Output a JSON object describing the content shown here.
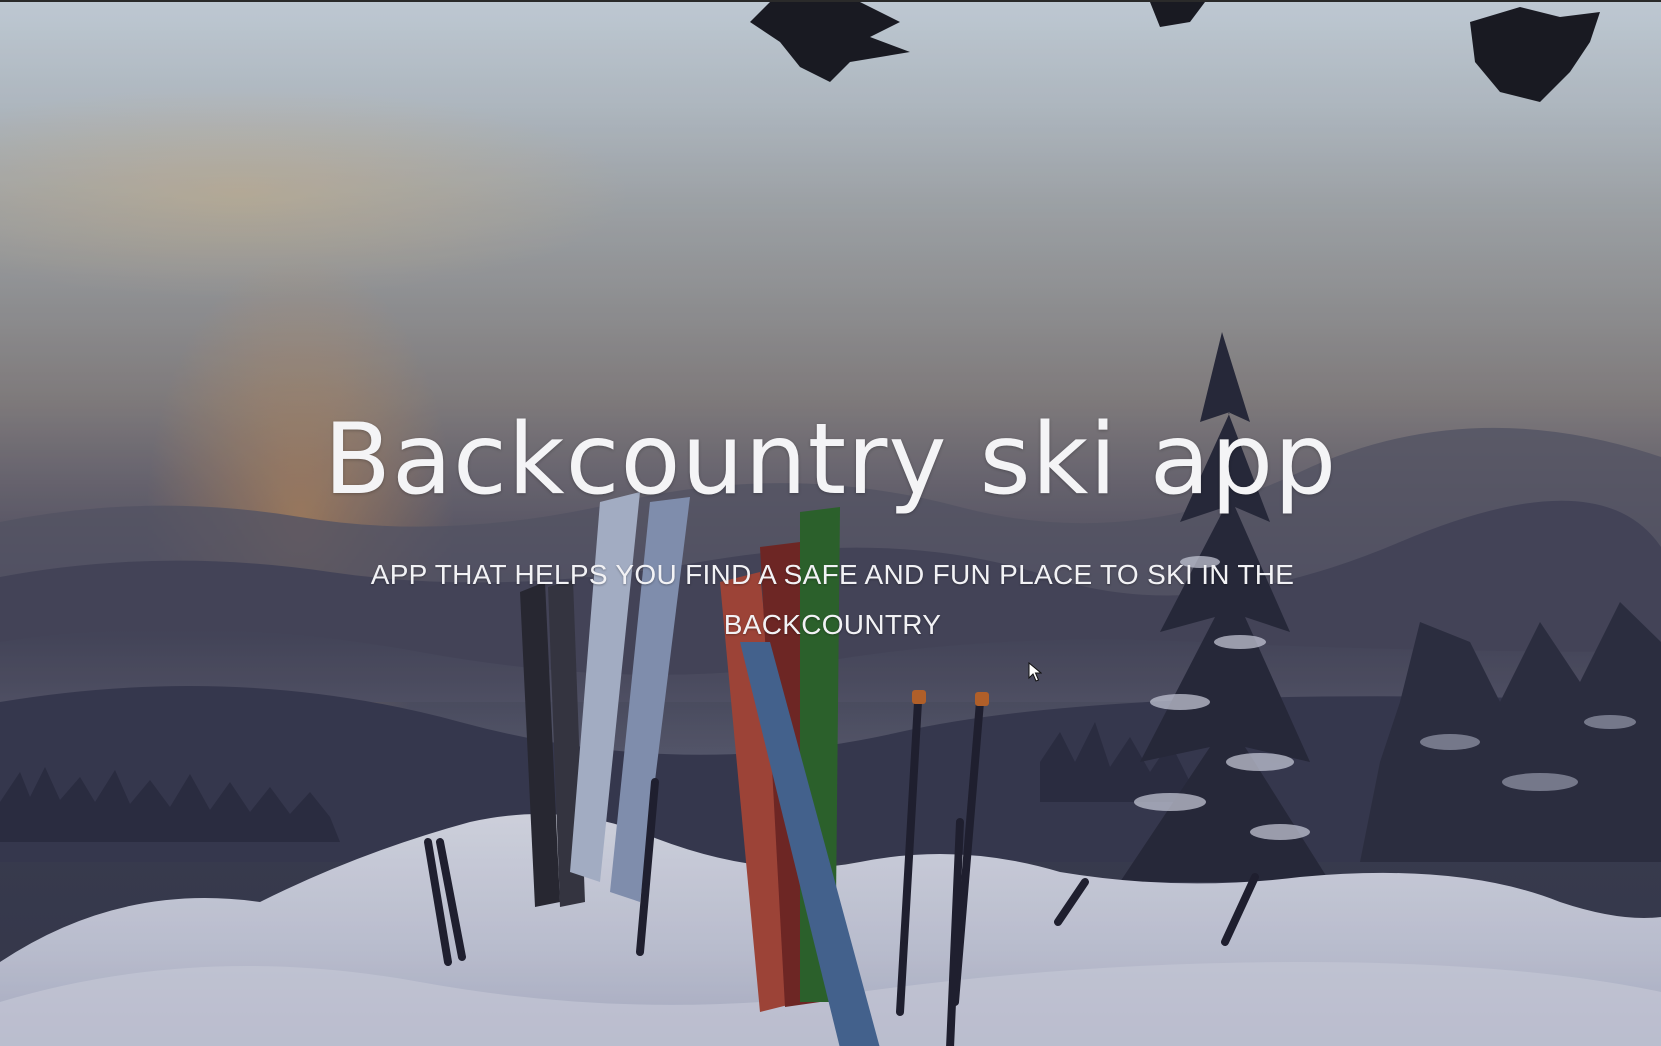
{
  "hero": {
    "title": "Backcountry ski app",
    "subtitle": "APP THAT HELPS YOU FIND A SAFE AND FUN PLACE TO SKI IN THE BACKCOUNTRY"
  },
  "background": {
    "image": "skis-in-snow-at-sunset",
    "sky_top_color": "#d6e2ea",
    "snow_color": "#dfe2ee",
    "forest_color": "#2e3042"
  },
  "icons": {
    "cursor": "mouse-pointer-icon"
  }
}
